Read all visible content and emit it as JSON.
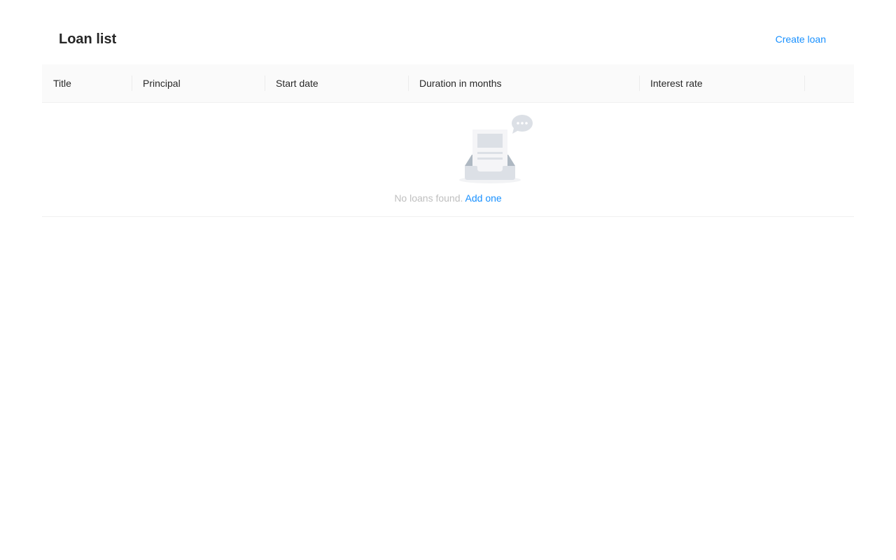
{
  "header": {
    "title": "Loan list",
    "create_label": "Create loan"
  },
  "table": {
    "columns": [
      "Title",
      "Principal",
      "Start date",
      "Duration in months",
      "Interest rate",
      ""
    ],
    "empty": {
      "description": "No loans found.",
      "action_label": "Add one",
      "icon": "empty-inbox-icon"
    }
  },
  "colors": {
    "accent": "#1890ff",
    "header_bg": "#fafafa",
    "muted_text": "#bfbfbf"
  }
}
